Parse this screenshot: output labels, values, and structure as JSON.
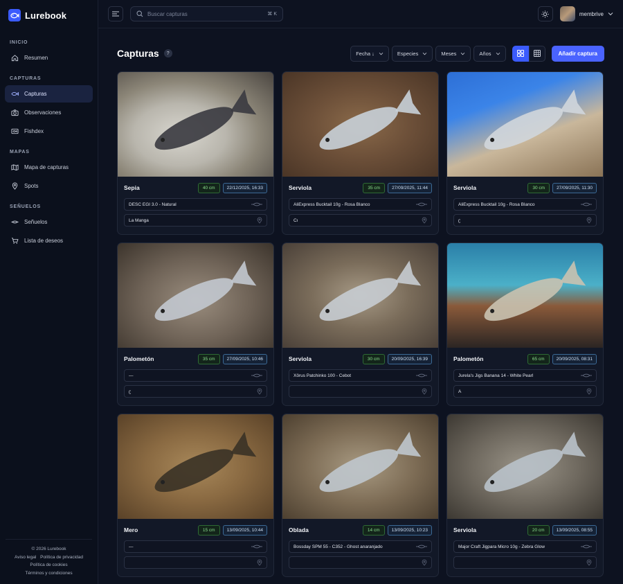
{
  "brand": {
    "name": "Lurebook"
  },
  "sidebar": {
    "sections": [
      {
        "label": "INICIO",
        "items": [
          {
            "label": "Resumen",
            "icon": "home-icon"
          }
        ]
      },
      {
        "label": "CAPTURAS",
        "items": [
          {
            "label": "Capturas",
            "icon": "fish-icon",
            "active": true
          },
          {
            "label": "Observaciones",
            "icon": "camera-icon"
          },
          {
            "label": "Fishdex",
            "icon": "fishdex-icon"
          }
        ]
      },
      {
        "label": "MAPAS",
        "items": [
          {
            "label": "Mapa de capturas",
            "icon": "map-icon"
          },
          {
            "label": "Spots",
            "icon": "pin-icon"
          }
        ]
      },
      {
        "label": "SEÑUELOS",
        "items": [
          {
            "label": "Señuelos",
            "icon": "lure-icon"
          },
          {
            "label": "Lista de deseos",
            "icon": "cart-icon"
          }
        ]
      }
    ],
    "footer": {
      "copyright": "© 2026 Lurebook",
      "aviso": "Aviso legal",
      "privacidad": "Política de privacidad",
      "cookies": "Política de cookies",
      "terminos": "Términos y condiciones"
    }
  },
  "topbar": {
    "search_placeholder": "Buscar capturas",
    "shortcut": "⌘ K",
    "username": "membrive"
  },
  "page": {
    "title": "Capturas",
    "help": "?",
    "filters": {
      "fecha": "Fecha ↓",
      "especies": "Especies",
      "meses": "Meses",
      "anos": "Años"
    },
    "add_button": "Añadir captura"
  },
  "cards": [
    {
      "species": "Sepia",
      "size": "40 cm",
      "date": "22/12/2025, 16:33",
      "lure": "DESC EGI 3.0 - Natural",
      "place": "La Manga"
    },
    {
      "species": "Serviola",
      "size": "35 cm",
      "date": "27/09/2025, 11:44",
      "lure": "AliExpress Bucktail 10g - Rosa Blanco",
      "place": "Cı"
    },
    {
      "species": "Serviola",
      "size": "30 cm",
      "date": "27/09/2025, 11:30",
      "lure": "AliExpress Bucktail 10g - Rosa Blanco",
      "place": "ʗ"
    },
    {
      "species": "Palometón",
      "size": "35 cm",
      "date": "27/09/2025, 10:46",
      "lure": "—",
      "place": "ʗ"
    },
    {
      "species": "Serviola",
      "size": "30 cm",
      "date": "20/09/2025, 16:39",
      "lure": "Xôrus Patchinko 100 - Cebot",
      "place": ""
    },
    {
      "species": "Palometón",
      "size": "65 cm",
      "date": "20/09/2025, 08:31",
      "lure": "Jurela's Jigs Banana 14 - White Pearl",
      "place": "A"
    },
    {
      "species": "Mero",
      "size": "15 cm",
      "date": "13/09/2025, 10:44",
      "lure": "—",
      "place": ""
    },
    {
      "species": "Oblada",
      "size": "14 cm",
      "date": "13/09/2025, 10:23",
      "lure": "Bossday SPM 55 - C352 - Ghost anaranjado",
      "place": ""
    },
    {
      "species": "Serviola",
      "size": "20 cm",
      "date": "13/09/2025, 08:55",
      "lure": "Major Craft Jigpara Micro 10g - Zebra Glow",
      "place": ""
    }
  ]
}
